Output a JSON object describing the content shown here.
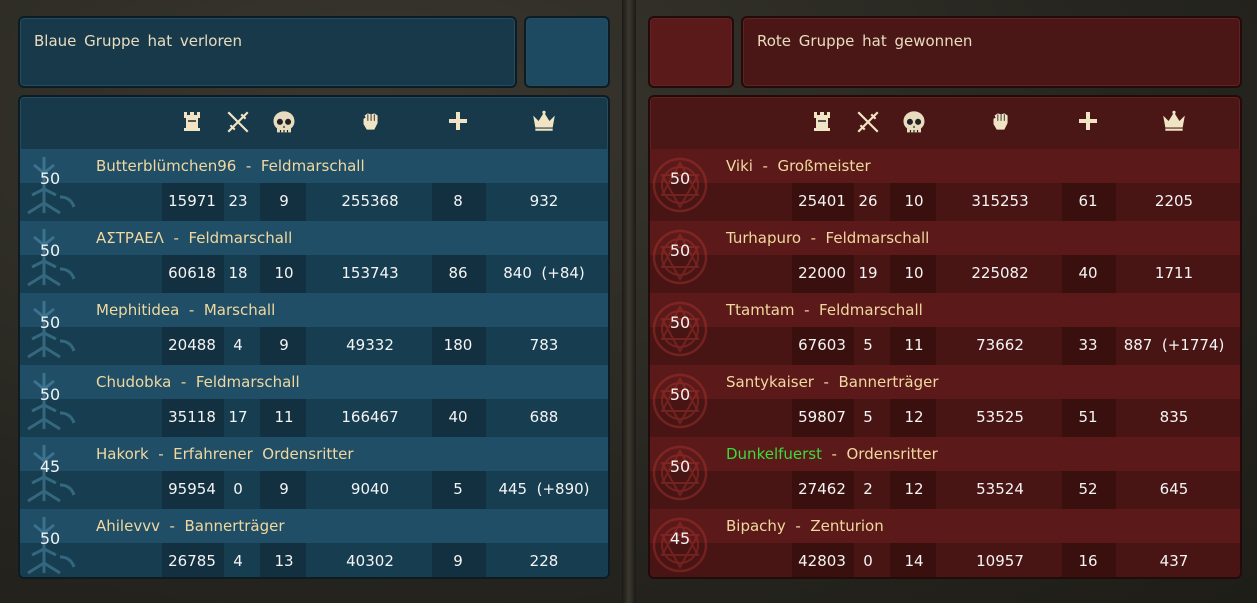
{
  "blue": {
    "title": "Blaue Gruppe hat verloren",
    "players": [
      {
        "level": "50",
        "name": "Butterblümchen96",
        "rank": "Feldmarschall",
        "stats": [
          "15971",
          "23",
          "9",
          "255368",
          "8",
          "932"
        ]
      },
      {
        "level": "50",
        "name": "ΑΣΤΡΑΕΛ",
        "rank": "Feldmarschall",
        "stats": [
          "60618",
          "18",
          "10",
          "153743",
          "86",
          "840  (+84)"
        ]
      },
      {
        "level": "50",
        "name": "Mephitidea",
        "rank": "Marschall",
        "stats": [
          "20488",
          "4",
          "9",
          "49332",
          "180",
          "783"
        ]
      },
      {
        "level": "50",
        "name": "Chudobka",
        "rank": "Feldmarschall",
        "stats": [
          "35118",
          "17",
          "11",
          "166467",
          "40",
          "688"
        ]
      },
      {
        "level": "45",
        "name": "Hakork",
        "rank": "Erfahrener  Ordensritter",
        "stats": [
          "95954",
          "0",
          "9",
          "9040",
          "5",
          "445  (+890)"
        ]
      },
      {
        "level": "50",
        "name": "Ahilevvv",
        "rank": "Bannerträger",
        "stats": [
          "26785",
          "4",
          "13",
          "40302",
          "9",
          "228"
        ]
      }
    ]
  },
  "red": {
    "title": "Rote Gruppe hat gewonnen",
    "players": [
      {
        "level": "50",
        "name": "Viki",
        "rank": "Großmeister",
        "stats": [
          "25401",
          "26",
          "10",
          "315253",
          "61",
          "2205"
        ]
      },
      {
        "level": "50",
        "name": "Turhapuro",
        "rank": "Feldmarschall",
        "stats": [
          "22000",
          "19",
          "10",
          "225082",
          "40",
          "1711"
        ]
      },
      {
        "level": "50",
        "name": "Ttamtam",
        "rank": "Feldmarschall",
        "stats": [
          "67603",
          "5",
          "11",
          "73662",
          "33",
          "887  (+1774)"
        ]
      },
      {
        "level": "50",
        "name": "Santykaiser",
        "rank": "Bannerträger",
        "stats": [
          "59807",
          "5",
          "12",
          "53525",
          "51",
          "835"
        ]
      },
      {
        "level": "50",
        "name": "Dunkelfuerst",
        "rank": "Ordensritter",
        "stats": [
          "27462",
          "2",
          "12",
          "53524",
          "52",
          "645"
        ],
        "highlight": true
      },
      {
        "level": "45",
        "name": "Bipachy",
        "rank": "Zenturion",
        "stats": [
          "42803",
          "0",
          "14",
          "10957",
          "16",
          "437"
        ]
      }
    ]
  },
  "name_separator": " - ",
  "header_icons": [
    "tower-icon",
    "crossed-swords-icon",
    "skull-icon",
    "fist-icon",
    "plus-icon",
    "crown-icon"
  ],
  "colors": {
    "blue_panel": "#17394a",
    "red_panel": "#4a1716",
    "highlight_name": "#3cdc3c",
    "name_text": "#f0d8a0"
  }
}
